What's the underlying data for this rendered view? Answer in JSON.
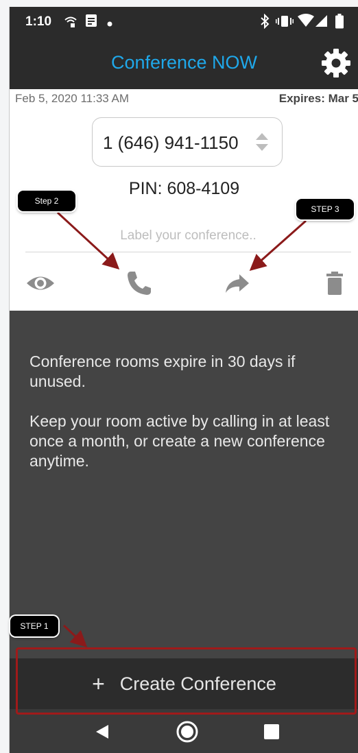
{
  "status_bar": {
    "time": "1:10",
    "left_icons": [
      "hotspot-icon",
      "message-icon",
      "notification-dot-icon"
    ],
    "right_icons": [
      "bluetooth-icon",
      "vibrate-icon",
      "wifi-icon",
      "signal-icon",
      "battery-icon"
    ]
  },
  "app_bar": {
    "title": "Conference NOW",
    "settings_icon": "gear-icon",
    "title_color": "#1fa8ea"
  },
  "conference": {
    "created": "Feb 5, 2020 11:33 AM",
    "expires": "Expires: Mar 5",
    "phone_number": "1 (646) 941-1150",
    "pin": "PIN: 608-4109",
    "label_placeholder": "Label your conference..",
    "actions": [
      "eye-icon",
      "phone-icon",
      "share-icon",
      "trash-icon"
    ]
  },
  "info": {
    "paragraph1": "Conference rooms expire in 30 days if unused.",
    "paragraph2": "Keep your room active by calling in at least once a month, or create a new conference anytime."
  },
  "create_button": {
    "plus": "+",
    "label": "Create Conference"
  },
  "nav_bar": [
    "back-icon",
    "home-icon",
    "recents-icon"
  ],
  "annotations": {
    "step1": "STEP 1",
    "step2": "Step 2",
    "step3": "STEP 3",
    "arrow_color": "#8b1a1a"
  }
}
